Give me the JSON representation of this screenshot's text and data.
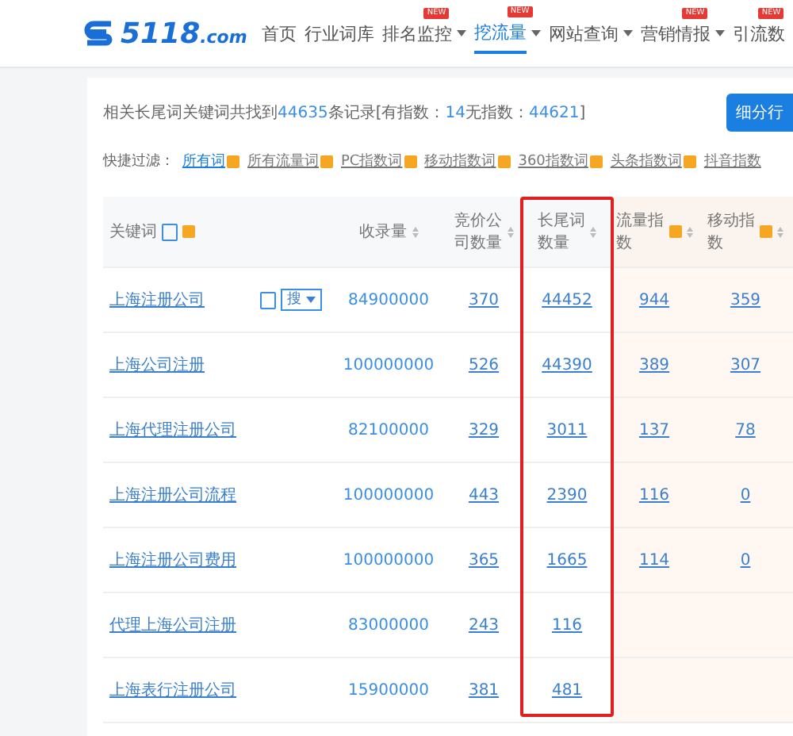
{
  "logo": {
    "number": "5118",
    "domain": ".com"
  },
  "nav": [
    {
      "label": "首页",
      "selected": false,
      "dropdown": false
    },
    {
      "label": "行业词库",
      "selected": false,
      "dropdown": false
    },
    {
      "label": "排名监控",
      "selected": false,
      "dropdown": true,
      "badge": "NEW"
    },
    {
      "label": "挖流量",
      "selected": true,
      "dropdown": true,
      "badge": "NEW"
    },
    {
      "label": "网站查询",
      "selected": false,
      "dropdown": true
    },
    {
      "label": "营销情报",
      "selected": false,
      "dropdown": true,
      "badge": "NEW"
    },
    {
      "label": "引流数",
      "selected": false,
      "dropdown": false,
      "badge": "NEW"
    }
  ],
  "summary": [
    {
      "text": "相关长尾词关键词共找到",
      "highlight": false
    },
    {
      "text": "44635",
      "highlight": true
    },
    {
      "text": "条记录[有指数：",
      "highlight": false
    },
    {
      "text": "14",
      "highlight": true
    },
    {
      "text": "无指数：",
      "highlight": false
    },
    {
      "text": "44621",
      "highlight": true
    },
    {
      "text": "]",
      "highlight": false
    }
  ],
  "action_button": "细分行",
  "filters": {
    "label": "快捷过滤：",
    "items": [
      {
        "label": "所有词",
        "selected": true,
        "help": true
      },
      {
        "label": "所有流量词",
        "selected": false,
        "help": true
      },
      {
        "label": "PC指数词",
        "selected": false,
        "help": true
      },
      {
        "label": "移动指数词",
        "selected": false,
        "help": true
      },
      {
        "label": "360指数词",
        "selected": false,
        "help": true
      },
      {
        "label": "头条指数词",
        "selected": false,
        "help": true
      },
      {
        "label": "抖音指数",
        "selected": false,
        "help": false
      }
    ]
  },
  "table": {
    "columns": [
      {
        "label": "关键词",
        "sortable": false,
        "help": true,
        "highlighted": false
      },
      {
        "label": "收录量",
        "sortable": true,
        "help": false,
        "highlighted": false
      },
      {
        "label": "竞价公司数量",
        "sortable": true,
        "help": false,
        "highlighted": false
      },
      {
        "label": "长尾词数量",
        "sortable": true,
        "help": false,
        "highlighted": true
      },
      {
        "label": "流量指数",
        "sortable": true,
        "help": true,
        "highlighted": false
      },
      {
        "label": "移动指数",
        "sortable": true,
        "help": true,
        "highlighted": false
      }
    ],
    "rows": [
      {
        "search_button": "搜",
        "cells": [
          "上海注册公司",
          "84900000",
          "370",
          "44452",
          "944",
          "359"
        ]
      },
      {
        "cells": [
          "上海公司注册",
          "100000000",
          "526",
          "44390",
          "389",
          "307"
        ]
      },
      {
        "cells": [
          "上海代理注册公司",
          "82100000",
          "329",
          "3011",
          "137",
          "78"
        ]
      },
      {
        "cells": [
          "上海注册公司流程",
          "100000000",
          "443",
          "2390",
          "116",
          "0"
        ]
      },
      {
        "cells": [
          "上海注册公司费用",
          "100000000",
          "365",
          "1665",
          "114",
          "0"
        ]
      },
      {
        "cells": [
          "代理上海公司注册",
          "83000000",
          "243",
          "116"
        ]
      },
      {
        "cells": [
          "上海表行注册公司",
          "15900000",
          "381",
          "481"
        ]
      }
    ]
  }
}
